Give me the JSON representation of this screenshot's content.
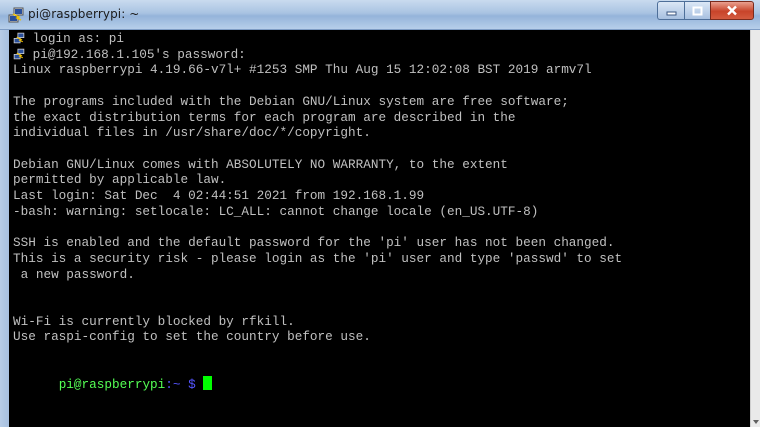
{
  "window": {
    "title": "pi@raspberrypi: ~"
  },
  "caption_buttons": {
    "minimize": "–",
    "maximize": "□",
    "close": "✕"
  },
  "terminal": {
    "lines": [
      " login as: pi",
      " pi@192.168.1.105's password:",
      "Linux raspberrypi 4.19.66-v7l+ #1253 SMP Thu Aug 15 12:02:08 BST 2019 armv7l",
      "",
      "The programs included with the Debian GNU/Linux system are free software;",
      "the exact distribution terms for each program are described in the",
      "individual files in /usr/share/doc/*/copyright.",
      "",
      "Debian GNU/Linux comes with ABSOLUTELY NO WARRANTY, to the extent",
      "permitted by applicable law.",
      "Last login: Sat Dec  4 02:44:51 2021 from 192.168.1.99",
      "-bash: warning: setlocale: LC_ALL: cannot change locale (en_US.UTF-8)",
      "",
      "SSH is enabled and the default password for the 'pi' user has not been changed.",
      "This is a security risk - please login as the 'pi' user and type 'passwd' to set",
      " a new password.",
      "",
      "",
      "Wi-Fi is currently blocked by rfkill.",
      "Use raspi-config to set the country before use.",
      ""
    ],
    "prompt": {
      "user_host": "pi@raspberrypi",
      "path": ":~ $"
    }
  },
  "icons": {
    "title": "putty-icon",
    "line_marker": "putty-icon"
  },
  "colors": {
    "prompt_user": "#54ff54",
    "prompt_path": "#5555ff",
    "cursor": "#00ff00",
    "text": "#c0c0c0"
  }
}
